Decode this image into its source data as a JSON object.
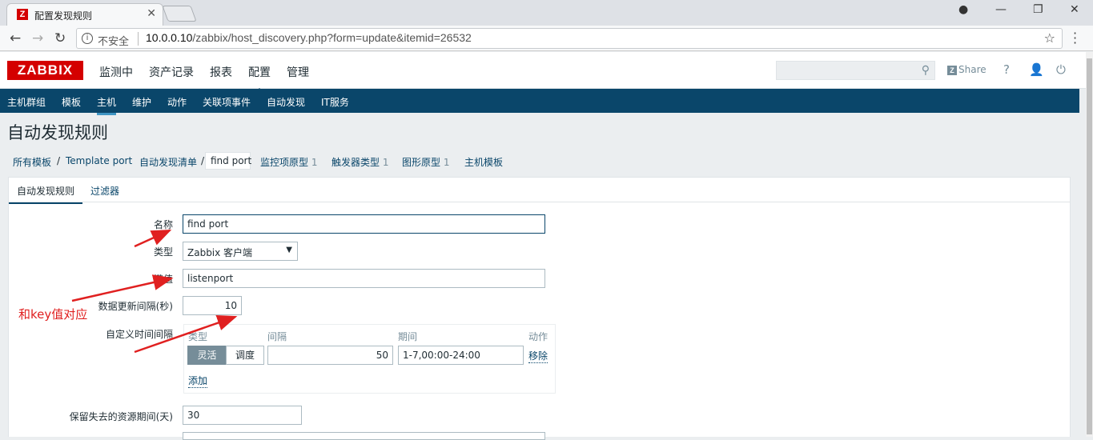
{
  "browser": {
    "tab_title": "配置发现规则",
    "favicon_letter": "Z",
    "insecure_label": "不安全",
    "url_host": "10.0.0.10",
    "url_path": "/zabbix/host_discovery.php?form=update&itemid=26532"
  },
  "header": {
    "logo": "ZABBIX",
    "menu": [
      "监测中",
      "资产记录",
      "报表",
      "配置",
      "管理"
    ],
    "active_menu": "配置",
    "share_label": "Share",
    "help_label": "?"
  },
  "subnav": {
    "items": [
      "主机群组",
      "模板",
      "主机",
      "维护",
      "动作",
      "关联项事件",
      "自动发现",
      "IT服务"
    ],
    "active": "主机"
  },
  "page_title": "自动发现规则",
  "breadcrumbs": {
    "all_templates": "所有模板",
    "template": "Template port",
    "discovery_list": "自动发现清单",
    "current": "find port",
    "item_prototypes": "监控项原型",
    "item_prototypes_count": "1",
    "trigger_prototypes": "触发器类型",
    "trigger_prototypes_count": "1",
    "graph_prototypes": "图形原型",
    "graph_prototypes_count": "1",
    "host_templates": "主机模板"
  },
  "form_tabs": {
    "discovery_rule": "自动发现规则",
    "filters": "过滤器"
  },
  "form": {
    "name_label": "名称",
    "name_value": "find port",
    "type_label": "类型",
    "type_value": "Zabbix 客户端",
    "key_label": "键值",
    "key_value": "listenport",
    "update_interval_label": "数据更新间隔(秒)",
    "update_interval_value": "10",
    "custom_intervals_label": "自定义时间间隔",
    "custom_intervals": {
      "col_type": "类型",
      "col_interval": "间隔",
      "col_period": "期间",
      "col_action": "动作",
      "mode_flexible": "灵活",
      "mode_scheduling": "调度",
      "interval_value": "50",
      "period_value": "1-7,00:00-24:00",
      "remove_link": "移除",
      "add_link": "添加"
    },
    "keep_lost_label": "保留失去的资源期间(天)",
    "keep_lost_value": "30"
  },
  "annotation": {
    "note": "和key值对应",
    "color": "#e02020"
  },
  "colors": {
    "brand": "#d40000",
    "nav": "#0a466a",
    "link": "#0a466a"
  }
}
